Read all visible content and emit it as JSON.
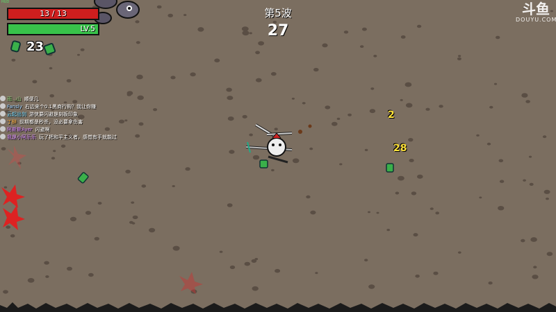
{
  "hud": {
    "hp": {
      "text": "13 / 13",
      "fraction": 1.0,
      "color": "#cf1e1e"
    },
    "xp": {
      "text": "LV.5",
      "fraction": 1.0,
      "color": "#38c24a"
    },
    "materials": "23",
    "corner_tag": "HUD"
  },
  "wave": {
    "title": "第5波",
    "timer": "27"
  },
  "damage_numbers": [
    "2",
    "28"
  ],
  "watermark": {
    "logo": "斗鱼",
    "site": "DOUYU.COM"
  },
  "chat": [
    {
      "user": "雨...山",
      "text": "顺便几",
      "user_color": "#8fd07a"
    },
    {
      "user": "Fansly",
      "text": "右边来个0.1黑商行购？我让你赚",
      "user_color": "#9ad0ff"
    },
    {
      "user": "云起出剑",
      "text": "游侠要闪避是刻板印象",
      "user_color": "#6ad6ff"
    },
    {
      "user": "丁醉",
      "text": "前期都是秒杀，没必要拿伤害",
      "user_color": "#ffb347"
    },
    {
      "user": "阿斯斯Ayer",
      "text": "闪避啊",
      "user_color": "#d68aff"
    },
    {
      "user": "我是小阿乐乐",
      "text": "玩了把和平主义者，感觉有手就能过",
      "user_color": "#d68aff"
    }
  ],
  "icons": [
    "material-icon",
    "loot-crate-icon",
    "player-character",
    "enemy-spawn-marker",
    "enemy-blob"
  ]
}
